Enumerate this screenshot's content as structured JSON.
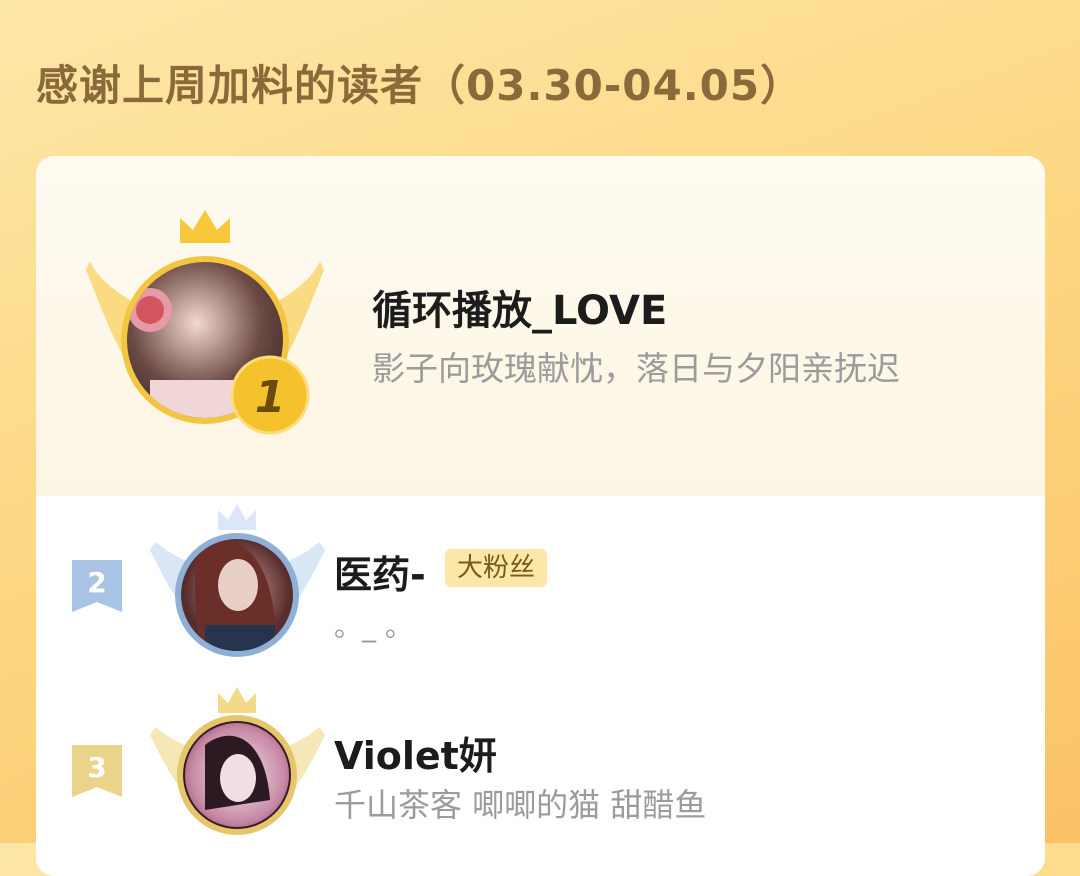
{
  "header": {
    "title": "感谢上周加料的读者（03.30-04.05）"
  },
  "leaderboard": [
    {
      "rank": "1",
      "name": "循环播放_LOVE",
      "subtitle": "影子向玫瑰献忱，落日与夕阳亲抚迟"
    },
    {
      "rank": "2",
      "name": "医药-",
      "badge": "大粉丝",
      "subtitle": "。_ 。"
    },
    {
      "rank": "3",
      "name": "Violet妍",
      "subtitle": "千山茶客 唧唧的猫 甜醋鱼"
    }
  ],
  "colors": {
    "gold": "#f5c22e",
    "silver": "#8fb0d6",
    "bronze": "#e6c66a",
    "title": "#8a6a3a"
  }
}
